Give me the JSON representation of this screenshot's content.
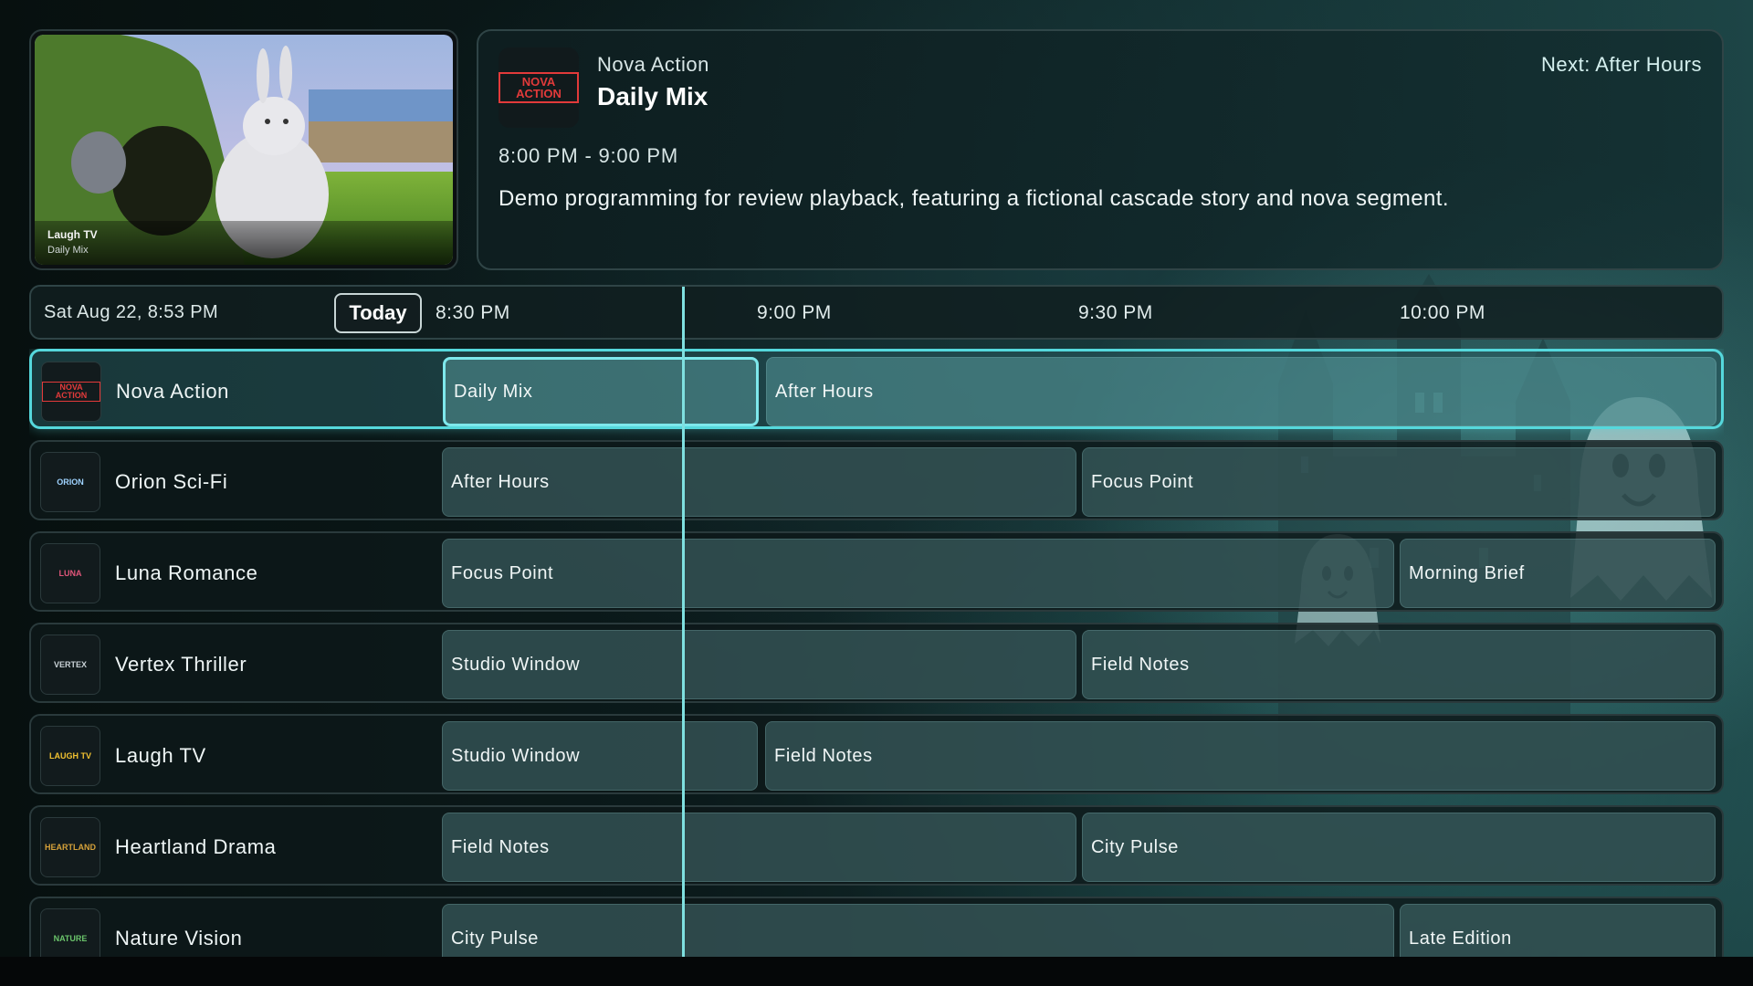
{
  "preview": {
    "channel": "Laugh TV",
    "program": "Daily Mix"
  },
  "info": {
    "channel": "Nova Action",
    "title": "Daily Mix",
    "next": "Next: After Hours",
    "time": "8:00 PM - 9:00 PM",
    "description": "Demo programming for review playback, featuring a fictional cascade story and nova segment."
  },
  "timebar": {
    "date": "Sat Aug 22, 8:53 PM",
    "today_label": "Today",
    "times": [
      "8:30 PM",
      "9:00 PM",
      "9:30 PM",
      "10:00 PM"
    ]
  },
  "channels": [
    {
      "name": "Nova Action",
      "logo": "NOVA ACTION",
      "logo_color": "#d82b2b",
      "programs": [
        "Daily Mix",
        "After Hours"
      ]
    },
    {
      "name": "Orion Sci-Fi",
      "logo": "ORION",
      "logo_color": "#9fd3ff",
      "programs": [
        "After Hours",
        "Focus Point"
      ]
    },
    {
      "name": "Luna Romance",
      "logo": "LUNA",
      "logo_color": "#e0567a",
      "programs": [
        "Focus Point",
        "Morning Brief"
      ]
    },
    {
      "name": "Vertex Thriller",
      "logo": "VERTEX",
      "logo_color": "#c9d2d6",
      "programs": [
        "Studio Window",
        "Field Notes"
      ]
    },
    {
      "name": "Laugh TV",
      "logo": "LAUGH TV",
      "logo_color": "#f2c230",
      "programs": [
        "Studio Window",
        "Field Notes"
      ]
    },
    {
      "name": "Heartland Drama",
      "logo": "HEARTLAND",
      "logo_color": "#d6a23a",
      "programs": [
        "Field Notes",
        "City Pulse"
      ]
    },
    {
      "name": "Nature Vision",
      "logo": "NATURE",
      "logo_color": "#6bc46b",
      "programs": [
        "City Pulse",
        "Late Edition"
      ]
    }
  ],
  "colors": {
    "accent": "#55d8dc",
    "now_line": "#7fe0e0"
  }
}
